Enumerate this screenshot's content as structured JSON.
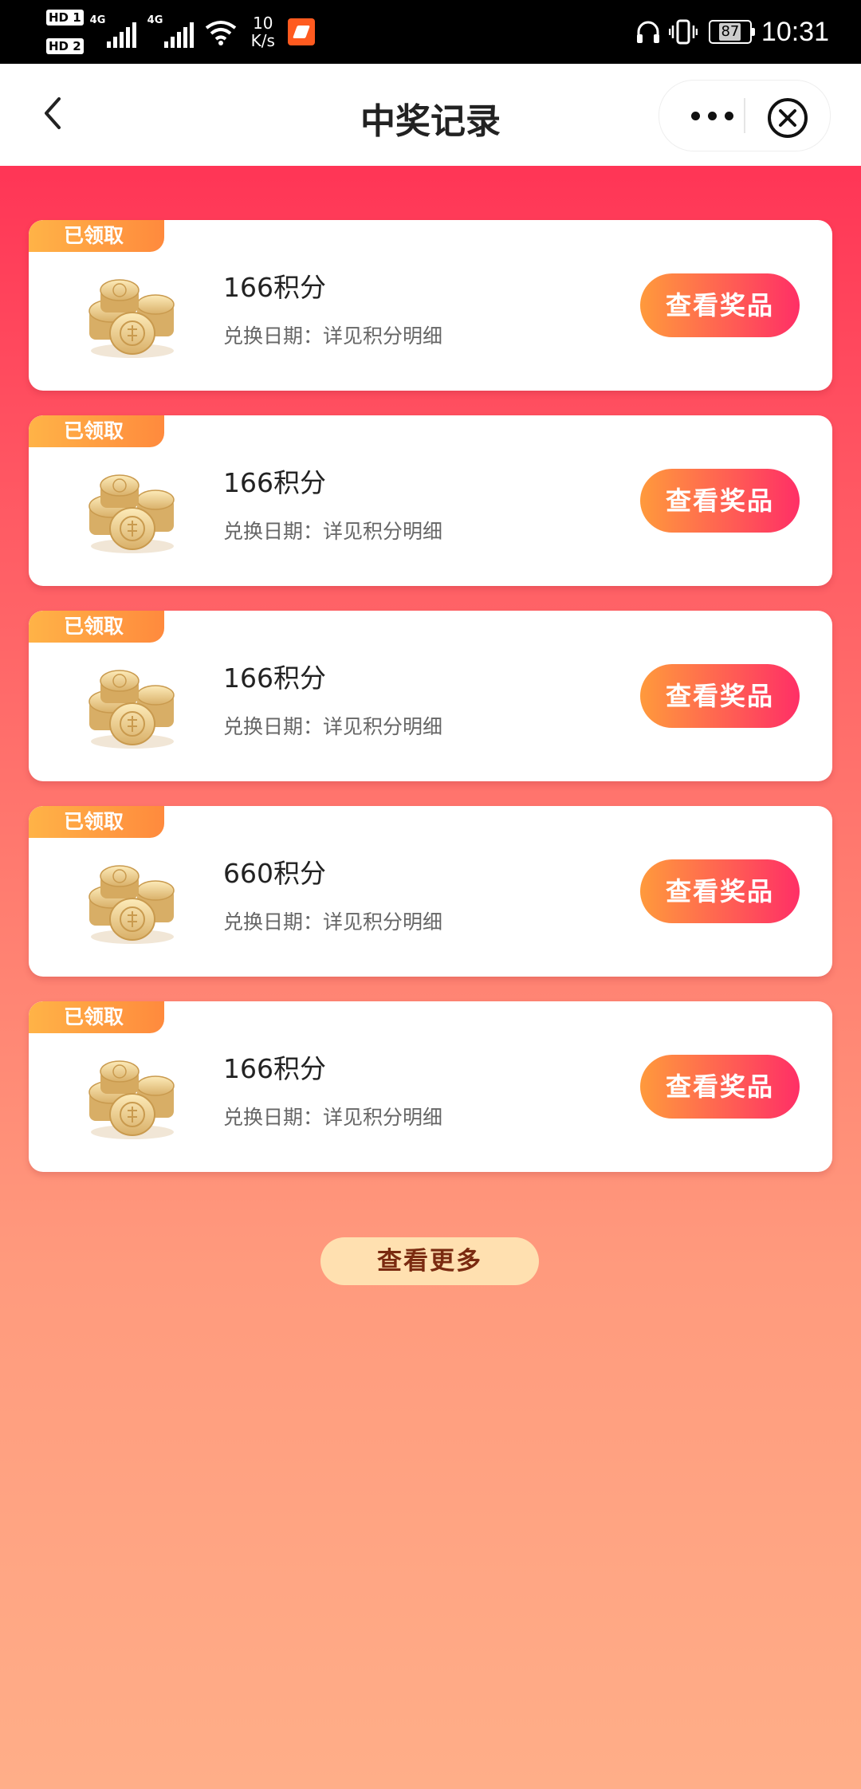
{
  "status_bar": {
    "hd1": "HD 1",
    "hd2": "HD 2",
    "net1": "4G",
    "net2": "4G",
    "speed_value": "10",
    "speed_unit": "K/s",
    "battery": "87",
    "time": "10:31"
  },
  "header": {
    "title": "中奖记录"
  },
  "records": [
    {
      "badge": "已领取",
      "name": "166积分",
      "date": "兑换日期：详见积分明细",
      "button": "查看奖品"
    },
    {
      "badge": "已领取",
      "name": "166积分",
      "date": "兑换日期：详见积分明细",
      "button": "查看奖品"
    },
    {
      "badge": "已领取",
      "name": "166积分",
      "date": "兑换日期：详见积分明细",
      "button": "查看奖品"
    },
    {
      "badge": "已领取",
      "name": "660积分",
      "date": "兑换日期：详见积分明细",
      "button": "查看奖品"
    },
    {
      "badge": "已领取",
      "name": "166积分",
      "date": "兑换日期：详见积分明细",
      "button": "查看奖品"
    }
  ],
  "more_button": "查看更多",
  "colors": {
    "gradient_top": "#ff3556",
    "gradient_bottom": "#ffae88",
    "badge": "#ff9a3c",
    "button_start": "#ff9a3c",
    "button_end": "#ff2f66",
    "more_bg": "#ffe0b0",
    "more_text": "#7a2a10"
  },
  "icons": [
    "back-arrow-icon",
    "more-dots-icon",
    "close-circle-icon",
    "coins-icon"
  ]
}
